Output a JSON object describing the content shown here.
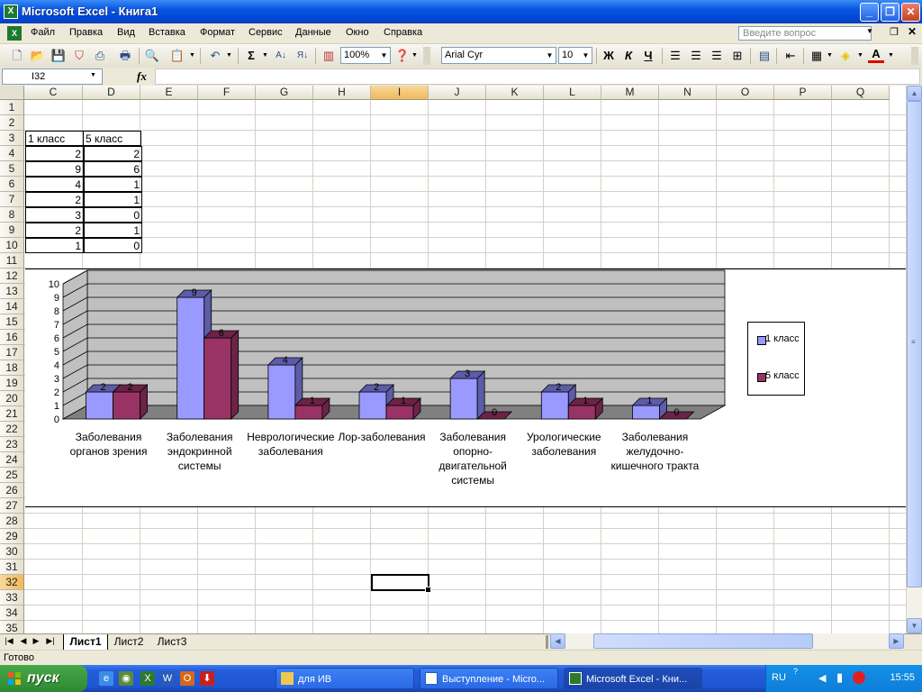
{
  "window": {
    "title": "Microsoft Excel - Книга1",
    "icon": "excel-icon"
  },
  "menu": {
    "items": [
      "Файл",
      "Правка",
      "Вид",
      "Вставка",
      "Формат",
      "Сервис",
      "Данные",
      "Окно",
      "Справка"
    ],
    "ask_placeholder": "Введите вопрос"
  },
  "toolbar": {
    "zoom": "100%",
    "font": "Arial Cyr",
    "font_size": "10",
    "bold": "Ж",
    "italic": "К",
    "underline": "Ч"
  },
  "formula_bar": {
    "name_box": "I32",
    "fx": "fx",
    "formula": ""
  },
  "columns": [
    "C",
    "D",
    "E",
    "F",
    "G",
    "H",
    "I",
    "J",
    "K",
    "L",
    "M",
    "N",
    "O",
    "P",
    "Q"
  ],
  "selected_column": "I",
  "rows": [
    "1",
    "2",
    "3",
    "4",
    "5",
    "6",
    "7",
    "8",
    "9",
    "10",
    "11",
    "12",
    "13",
    "14",
    "15",
    "16",
    "17",
    "18",
    "19",
    "20",
    "21",
    "22",
    "23",
    "24",
    "25",
    "26",
    "27",
    "28",
    "29",
    "30",
    "31",
    "32",
    "33",
    "34",
    "35"
  ],
  "selected_row": "32",
  "table": {
    "header_c": "1 класс",
    "header_d": "5 класс",
    "col_c": [
      2,
      9,
      4,
      2,
      3,
      2,
      1
    ],
    "col_d": [
      2,
      6,
      1,
      1,
      0,
      1,
      0
    ]
  },
  "chart_data": {
    "type": "bar",
    "categories": [
      "Заболевания органов зрения",
      "Заболевания эндокринной системы",
      "Неврологические заболевания",
      "Лор-заболевания",
      "Заболевания опорно-двигательной системы",
      "Урологические заболевания",
      "Заболевания желудочно-кишечного тракта"
    ],
    "category_lines": [
      [
        "Заболевания",
        "органов зрения"
      ],
      [
        "Заболевания",
        "эндокринной",
        "системы"
      ],
      [
        "Неврологические",
        "заболевания"
      ],
      [
        "Лор-заболевания"
      ],
      [
        "Заболевания",
        "опорно-",
        "двигательной",
        "системы"
      ],
      [
        "Урологические",
        "заболевания"
      ],
      [
        "Заболевания",
        "желудочно-",
        "кишечного тракта"
      ]
    ],
    "series": [
      {
        "name": "1 класс",
        "values": [
          2,
          9,
          4,
          2,
          3,
          2,
          1
        ],
        "color": "#9999ff"
      },
      {
        "name": "5 класс",
        "values": [
          2,
          6,
          1,
          1,
          0,
          1,
          0
        ],
        "color": "#993366"
      }
    ],
    "ylim": [
      0,
      10
    ],
    "yticks": [
      "0",
      "1",
      "2",
      "3",
      "4",
      "5",
      "6",
      "7",
      "8",
      "9",
      "10"
    ],
    "grid": true,
    "legend": "right",
    "wall_color": "#c0c0c0",
    "floor_color": "#808080"
  },
  "sheets": {
    "tabs": [
      "Лист1",
      "Лист2",
      "Лист3"
    ],
    "active": "Лист1"
  },
  "status": {
    "text": "Готово"
  },
  "taskbar": {
    "start": "пуск",
    "tasks": [
      "для ИВ",
      "Выступление - Micro...",
      "Microsoft Excel - Кни..."
    ],
    "active_task": 2,
    "lang": "RU",
    "clock": "15:55"
  }
}
